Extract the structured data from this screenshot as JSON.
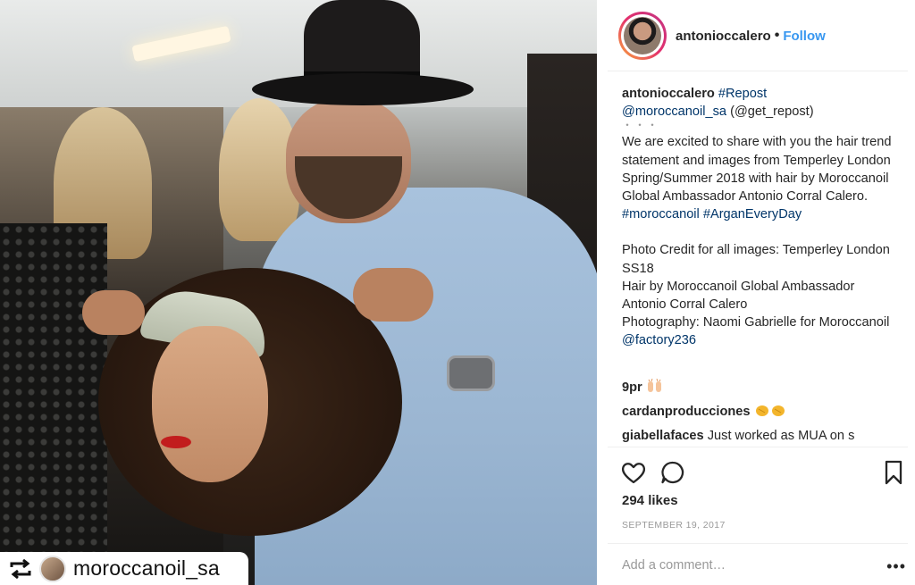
{
  "header": {
    "username": "antonioccalero",
    "separator": "•",
    "follow_label": "Follow"
  },
  "caption": {
    "username": "antonioccalero",
    "repost_tag": "#Repost",
    "source_handle": "@moroccanoil_sa",
    "get_repost": "(@get_repost)",
    "dots": "・・・",
    "body": "We are excited to share with you the hair trend statement and images from Temperley London Spring/Summer 2018 with hair by Moroccanoil Global Ambassador Antonio Corral Calero.",
    "hashtags": "#moroccanoil #ArganEveryDay",
    "credit": "Photo Credit for all images: Temperley London SS18\nHair by Moroccanoil Global Ambassador Antonio Corral Calero\nPhotography: Naomi Gabrielle for Moroccanoil ",
    "credit_handle": "@factory236"
  },
  "comments": [
    {
      "username": "9pr",
      "text": "",
      "emoji": "raised-hands"
    },
    {
      "username": "cardanproducciones",
      "text": "",
      "emoji": "clapping-hands"
    },
    {
      "username": "giabellafaces",
      "text": "Just worked as MUA on s"
    }
  ],
  "actions": {
    "likes": "294 likes",
    "date": "SEPTEMBER 19, 2017",
    "comment_placeholder": "Add a comment…",
    "more": "•••"
  },
  "repost_overlay": {
    "username": "moroccanoil_sa"
  },
  "colors": {
    "follow": "#3897f0",
    "link": "#003569",
    "muted": "#999999",
    "text": "#262626"
  }
}
